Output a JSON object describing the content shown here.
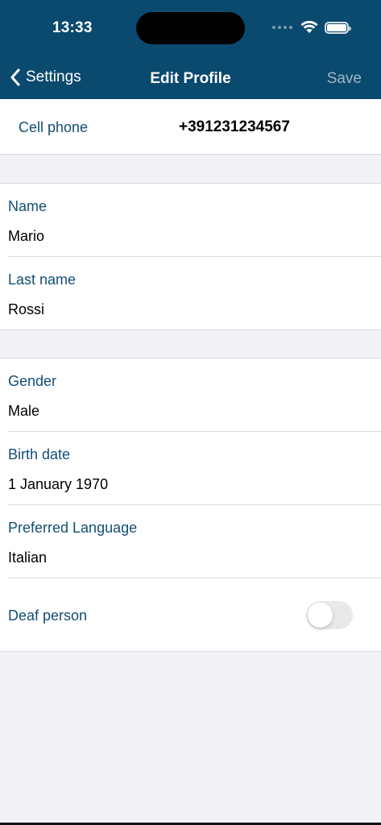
{
  "status": {
    "time": "13:33",
    "wifi_icon": "wifi-icon",
    "battery_icon": "battery-icon"
  },
  "nav": {
    "back_label": "Settings",
    "title": "Edit Profile",
    "save_label": "Save",
    "back_icon": "chevron-left-icon"
  },
  "phone": {
    "label": "Cell phone",
    "value": "+391231234567"
  },
  "fields": {
    "name": {
      "label": "Name",
      "value": "Mario"
    },
    "last_name": {
      "label": "Last name",
      "value": "Rossi"
    },
    "gender": {
      "label": "Gender",
      "value": "Male"
    },
    "birth_date": {
      "label": "Birth date",
      "value": "1 January 1970"
    },
    "language": {
      "label": "Preferred Language",
      "value": "Italian"
    }
  },
  "deaf": {
    "label": "Deaf person",
    "enabled": false
  },
  "colors": {
    "header": "#0b4a6f",
    "label": "#124e75",
    "background": "#f2f2f7"
  }
}
